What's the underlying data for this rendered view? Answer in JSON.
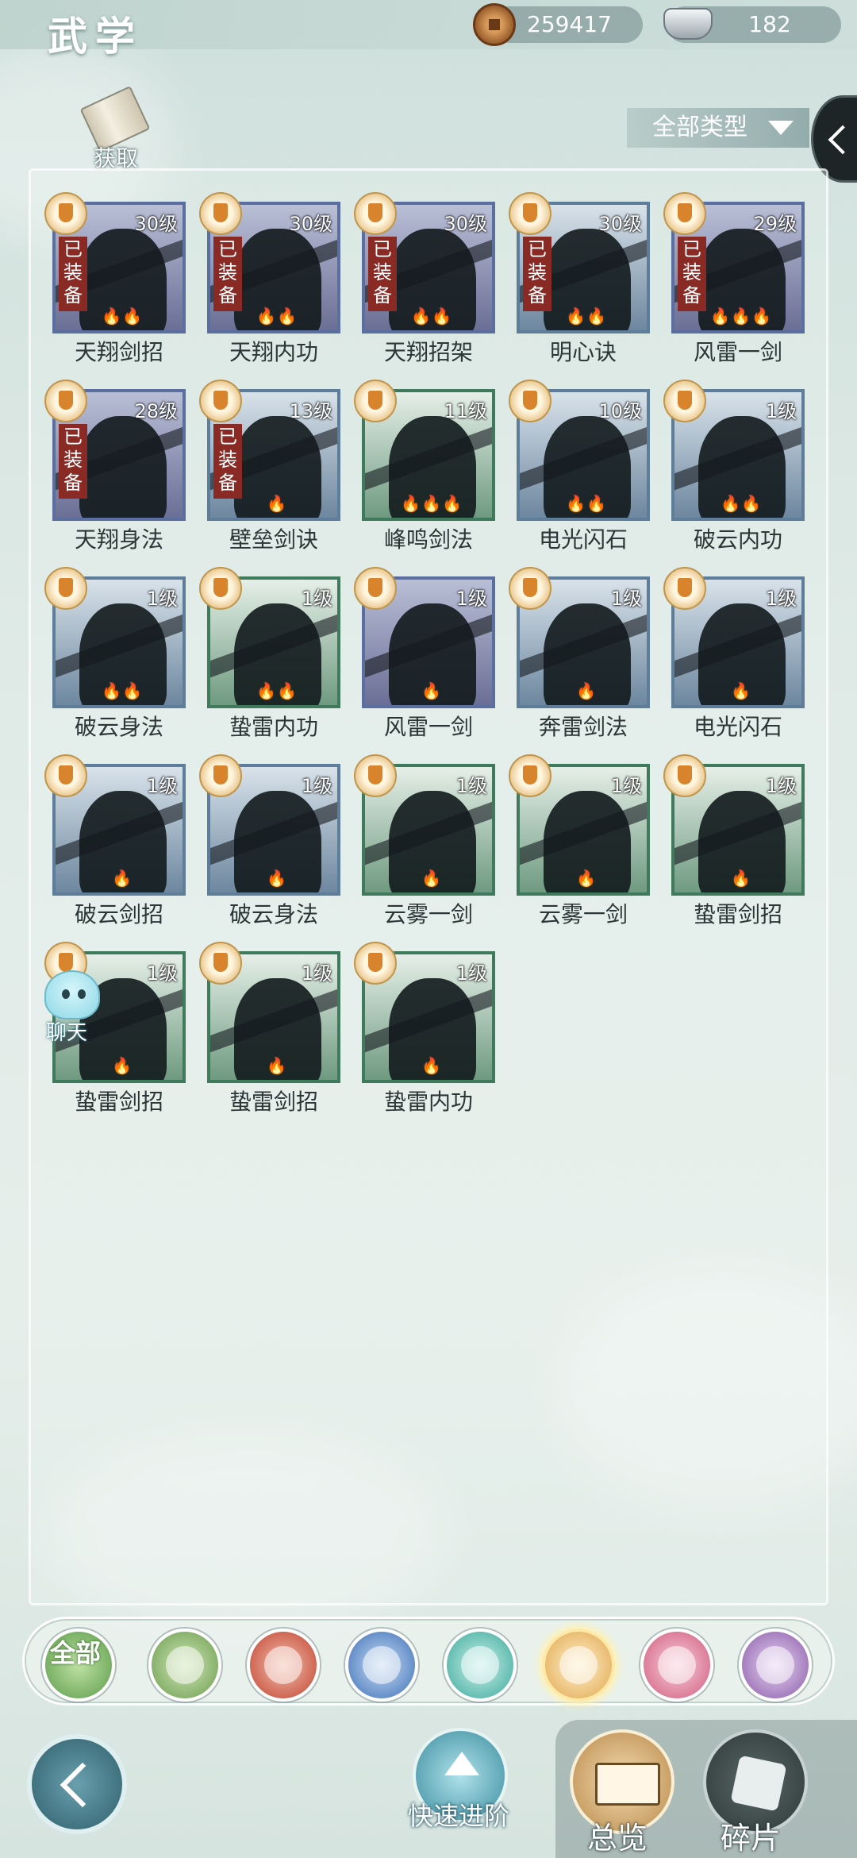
{
  "header": {
    "title": "武学",
    "copper": "259417",
    "silver": "182",
    "obtain_label": "获取",
    "type_filter": "全部类型"
  },
  "equipped_label": "已装备",
  "skills": [
    {
      "name": "天翔剑招",
      "level": "30级",
      "equipped": true,
      "flames": "💧💧",
      "tone": "purple"
    },
    {
      "name": "天翔内功",
      "level": "30级",
      "equipped": true,
      "flames": "💧💧",
      "tone": "purple"
    },
    {
      "name": "天翔招架",
      "level": "30级",
      "equipped": true,
      "flames": "💧💧",
      "tone": "purple"
    },
    {
      "name": "明心诀",
      "level": "30级",
      "equipped": true,
      "flames": "💧💧",
      "tone": "blue"
    },
    {
      "name": "风雷一剑",
      "level": "29级",
      "equipped": true,
      "flames": "💧💧💧",
      "tone": "purple"
    },
    {
      "name": "天翔身法",
      "level": "28级",
      "equipped": true,
      "flames": "",
      "tone": "purple"
    },
    {
      "name": "壁垒剑诀",
      "level": "13级",
      "equipped": true,
      "flames": "💧",
      "tone": "blue"
    },
    {
      "name": "峰鸣剑法",
      "level": "11级",
      "equipped": false,
      "flames": "💧💧💧",
      "tone": "green"
    },
    {
      "name": "电光闪石",
      "level": "10级",
      "equipped": false,
      "flames": "💧💧",
      "tone": "blue"
    },
    {
      "name": "破云内功",
      "level": "1级",
      "equipped": false,
      "flames": "💧💧",
      "tone": "blue"
    },
    {
      "name": "破云身法",
      "level": "1级",
      "equipped": false,
      "flames": "💧💧",
      "tone": "blue"
    },
    {
      "name": "蛰雷内功",
      "level": "1级",
      "equipped": false,
      "flames": "💧💧",
      "tone": "green"
    },
    {
      "name": "风雷一剑",
      "level": "1级",
      "equipped": false,
      "flames": "💧",
      "tone": "purple"
    },
    {
      "name": "奔雷剑法",
      "level": "1级",
      "equipped": false,
      "flames": "💧",
      "tone": "blue"
    },
    {
      "name": "电光闪石",
      "level": "1级",
      "equipped": false,
      "flames": "💧",
      "tone": "blue"
    },
    {
      "name": "破云剑招",
      "level": "1级",
      "equipped": false,
      "flames": "💧",
      "tone": "blue"
    },
    {
      "name": "破云身法",
      "level": "1级",
      "equipped": false,
      "flames": "💧",
      "tone": "blue"
    },
    {
      "name": "云雾一剑",
      "level": "1级",
      "equipped": false,
      "flames": "💧",
      "tone": "green"
    },
    {
      "name": "云雾一剑",
      "level": "1级",
      "equipped": false,
      "flames": "💧",
      "tone": "green"
    },
    {
      "name": "蛰雷剑招",
      "level": "1级",
      "equipped": false,
      "flames": "💧",
      "tone": "green"
    },
    {
      "name": "蛰雷剑招",
      "level": "1级",
      "equipped": false,
      "flames": "💧",
      "tone": "green"
    },
    {
      "name": "蛰雷剑招",
      "level": "1级",
      "equipped": false,
      "flames": "💧",
      "tone": "green"
    },
    {
      "name": "蛰雷内功",
      "level": "1级",
      "equipped": false,
      "flames": "💧",
      "tone": "green"
    }
  ],
  "chat_label": "聊天",
  "categories": {
    "all_label": "全部",
    "items": [
      "sword-icon",
      "fire-icon",
      "wave-icon",
      "butterfly-icon",
      "shield-icon",
      "moon-icon",
      "rose-icon"
    ],
    "selected": "shield-icon"
  },
  "bottom": {
    "quick_advance": "快速进阶",
    "overview": "总览",
    "fragments": "碎片"
  }
}
